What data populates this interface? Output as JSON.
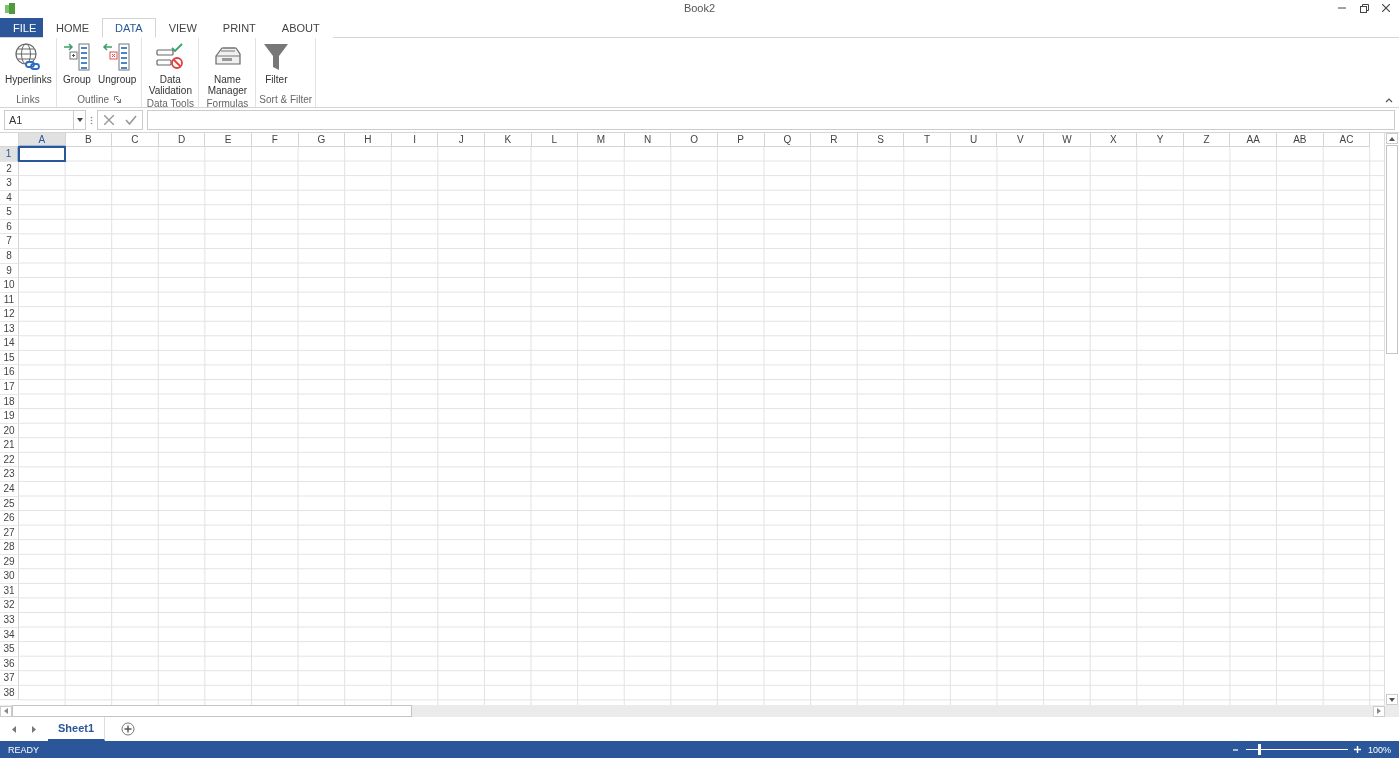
{
  "window": {
    "title": "Book2"
  },
  "ribbon_tabs": [
    {
      "label": "FILE",
      "kind": "file",
      "selected": false
    },
    {
      "label": "HOME",
      "kind": "tab",
      "selected": false
    },
    {
      "label": "DATA",
      "kind": "tab",
      "selected": true
    },
    {
      "label": "VIEW",
      "kind": "tab",
      "selected": false
    },
    {
      "label": "PRINT",
      "kind": "tab",
      "selected": false
    },
    {
      "label": "ABOUT",
      "kind": "tab",
      "selected": false
    }
  ],
  "ribbon_groups": [
    {
      "label": "Links",
      "launcher": false,
      "buttons": [
        {
          "label": "Hyperlinks",
          "kind": "hyperlink"
        }
      ]
    },
    {
      "label": "Outline",
      "launcher": true,
      "buttons": [
        {
          "label": "Group",
          "kind": "group"
        },
        {
          "label": "Ungroup",
          "kind": "ungroup"
        }
      ]
    },
    {
      "label": "Data Tools",
      "launcher": false,
      "buttons": [
        {
          "label": "Data Validation",
          "kind": "validation"
        }
      ]
    },
    {
      "label": "Formulas",
      "launcher": false,
      "buttons": [
        {
          "label": "Name Manager",
          "kind": "names"
        }
      ]
    },
    {
      "label": "Sort & Filter",
      "launcher": false,
      "buttons": [
        {
          "label": "Filter",
          "kind": "filter"
        }
      ]
    }
  ],
  "formula_bar": {
    "name_box": "A1"
  },
  "columns": [
    {
      "label": "A",
      "selected": true
    },
    {
      "label": "B",
      "selected": false
    },
    {
      "label": "C",
      "selected": false
    },
    {
      "label": "D",
      "selected": false
    },
    {
      "label": "E",
      "selected": false
    },
    {
      "label": "F",
      "selected": false
    },
    {
      "label": "G",
      "selected": false
    },
    {
      "label": "H",
      "selected": false
    },
    {
      "label": "I",
      "selected": false
    },
    {
      "label": "J",
      "selected": false
    },
    {
      "label": "K",
      "selected": false
    },
    {
      "label": "L",
      "selected": false
    },
    {
      "label": "M",
      "selected": false
    },
    {
      "label": "N",
      "selected": false
    },
    {
      "label": "O",
      "selected": false
    },
    {
      "label": "P",
      "selected": false
    },
    {
      "label": "Q",
      "selected": false
    },
    {
      "label": "R",
      "selected": false
    },
    {
      "label": "S",
      "selected": false
    },
    {
      "label": "T",
      "selected": false
    },
    {
      "label": "U",
      "selected": false
    },
    {
      "label": "V",
      "selected": false
    },
    {
      "label": "W",
      "selected": false
    },
    {
      "label": "X",
      "selected": false
    },
    {
      "label": "Y",
      "selected": false
    },
    {
      "label": "Z",
      "selected": false
    },
    {
      "label": "AA",
      "selected": false
    },
    {
      "label": "AB",
      "selected": false
    },
    {
      "label": "AC",
      "selected": false
    }
  ],
  "rows": [
    {
      "label": "1",
      "selected": true
    },
    {
      "label": "2",
      "selected": false
    },
    {
      "label": "3",
      "selected": false
    },
    {
      "label": "4",
      "selected": false
    },
    {
      "label": "5",
      "selected": false
    },
    {
      "label": "6",
      "selected": false
    },
    {
      "label": "7",
      "selected": false
    },
    {
      "label": "8",
      "selected": false
    },
    {
      "label": "9",
      "selected": false
    },
    {
      "label": "10",
      "selected": false
    },
    {
      "label": "11",
      "selected": false
    },
    {
      "label": "12",
      "selected": false
    },
    {
      "label": "13",
      "selected": false
    },
    {
      "label": "14",
      "selected": false
    },
    {
      "label": "15",
      "selected": false
    },
    {
      "label": "16",
      "selected": false
    },
    {
      "label": "17",
      "selected": false
    },
    {
      "label": "18",
      "selected": false
    },
    {
      "label": "19",
      "selected": false
    },
    {
      "label": "20",
      "selected": false
    },
    {
      "label": "21",
      "selected": false
    },
    {
      "label": "22",
      "selected": false
    },
    {
      "label": "23",
      "selected": false
    },
    {
      "label": "24",
      "selected": false
    },
    {
      "label": "25",
      "selected": false
    },
    {
      "label": "26",
      "selected": false
    },
    {
      "label": "27",
      "selected": false
    },
    {
      "label": "28",
      "selected": false
    },
    {
      "label": "29",
      "selected": false
    },
    {
      "label": "30",
      "selected": false
    },
    {
      "label": "31",
      "selected": false
    },
    {
      "label": "32",
      "selected": false
    },
    {
      "label": "33",
      "selected": false
    },
    {
      "label": "34",
      "selected": false
    },
    {
      "label": "35",
      "selected": false
    },
    {
      "label": "36",
      "selected": false
    },
    {
      "label": "37",
      "selected": false
    },
    {
      "label": "38",
      "selected": false
    }
  ],
  "sheet_tabs": [
    {
      "label": "Sheet1",
      "selected": true
    }
  ],
  "status_bar": {
    "status": "READY",
    "zoom": {
      "level": 0.12,
      "reading": "100%"
    }
  }
}
